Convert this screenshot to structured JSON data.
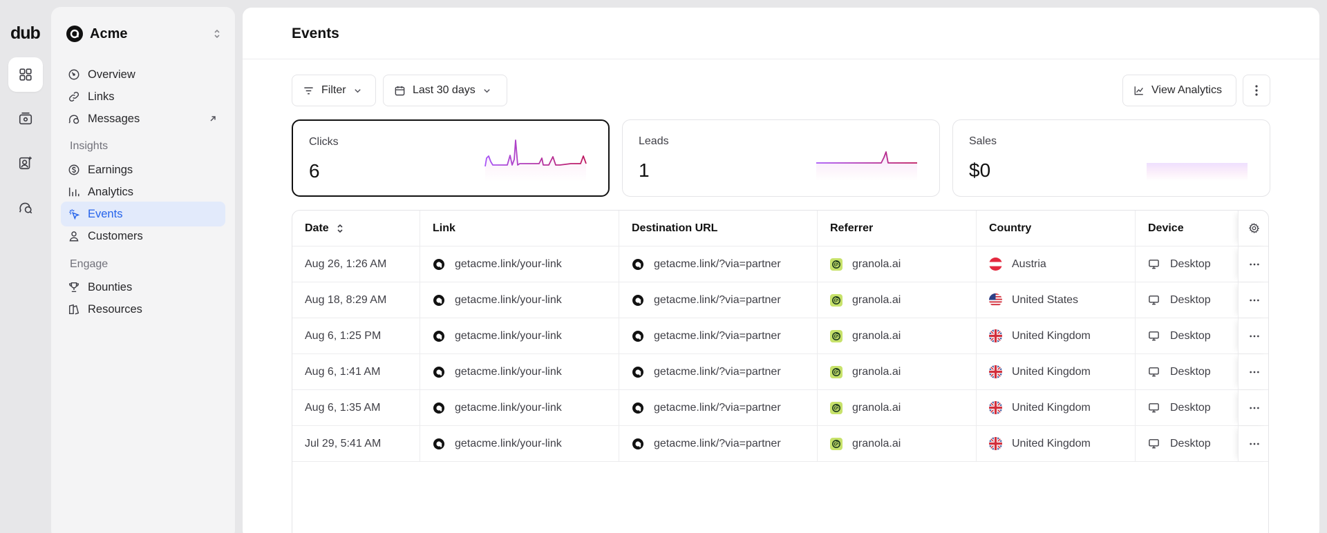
{
  "app": {
    "logo_text": "dub"
  },
  "rail": {
    "items": [
      "grid-icon",
      "wallet-icon",
      "user-plus-icon",
      "chat-icon"
    ]
  },
  "workspace": {
    "name": "Acme"
  },
  "nav": {
    "primary": [
      {
        "label": "Overview",
        "icon": "gauge-icon"
      },
      {
        "label": "Links",
        "icon": "link-icon"
      },
      {
        "label": "Messages",
        "icon": "chat-icon"
      }
    ],
    "insights_title": "Insights",
    "insights": [
      {
        "label": "Earnings",
        "icon": "dollar-icon"
      },
      {
        "label": "Analytics",
        "icon": "bar-chart-icon"
      },
      {
        "label": "Events",
        "icon": "cursor-rays-icon"
      },
      {
        "label": "Customers",
        "icon": "user-icon"
      }
    ],
    "engage_title": "Engage",
    "engage": [
      {
        "label": "Bounties",
        "icon": "trophy-icon"
      },
      {
        "label": "Resources",
        "icon": "resources-icon"
      }
    ]
  },
  "page": {
    "title": "Events"
  },
  "toolbar": {
    "filter_label": "Filter",
    "date_label": "Last 30 days",
    "view_analytics_label": "View Analytics"
  },
  "stats": [
    {
      "label": "Clicks",
      "value": "6"
    },
    {
      "label": "Leads",
      "value": "1"
    },
    {
      "label": "Sales",
      "value": "$0"
    }
  ],
  "table": {
    "headers": [
      "Date",
      "Link",
      "Destination URL",
      "Referrer",
      "Country",
      "Device"
    ],
    "rows": [
      {
        "date": "Aug 26, 1:26 AM",
        "link": "getacme.link/your-link",
        "dest": "getacme.link/?via=partner",
        "referrer": "granola.ai",
        "country": "Austria",
        "flag": "at",
        "device": "Desktop"
      },
      {
        "date": "Aug 18, 8:29 AM",
        "link": "getacme.link/your-link",
        "dest": "getacme.link/?via=partner",
        "referrer": "granola.ai",
        "country": "United States",
        "flag": "us",
        "device": "Desktop"
      },
      {
        "date": "Aug 6, 1:25 PM",
        "link": "getacme.link/your-link",
        "dest": "getacme.link/?via=partner",
        "referrer": "granola.ai",
        "country": "United Kingdom",
        "flag": "gb",
        "device": "Desktop"
      },
      {
        "date": "Aug 6, 1:41 AM",
        "link": "getacme.link/your-link",
        "dest": "getacme.link/?via=partner",
        "referrer": "granola.ai",
        "country": "United Kingdom",
        "flag": "gb",
        "device": "Desktop"
      },
      {
        "date": "Aug 6, 1:35 AM",
        "link": "getacme.link/your-link",
        "dest": "getacme.link/?via=partner",
        "referrer": "granola.ai",
        "country": "United Kingdom",
        "flag": "gb",
        "device": "Desktop"
      },
      {
        "date": "Jul 29, 5:41 AM",
        "link": "getacme.link/your-link",
        "dest": "getacme.link/?via=partner",
        "referrer": "granola.ai",
        "country": "United Kingdom",
        "flag": "gb",
        "device": "Desktop"
      }
    ]
  },
  "colors": {
    "accent": "#2563eb",
    "spark_start": "#a855f7",
    "spark_end": "#db2777"
  }
}
